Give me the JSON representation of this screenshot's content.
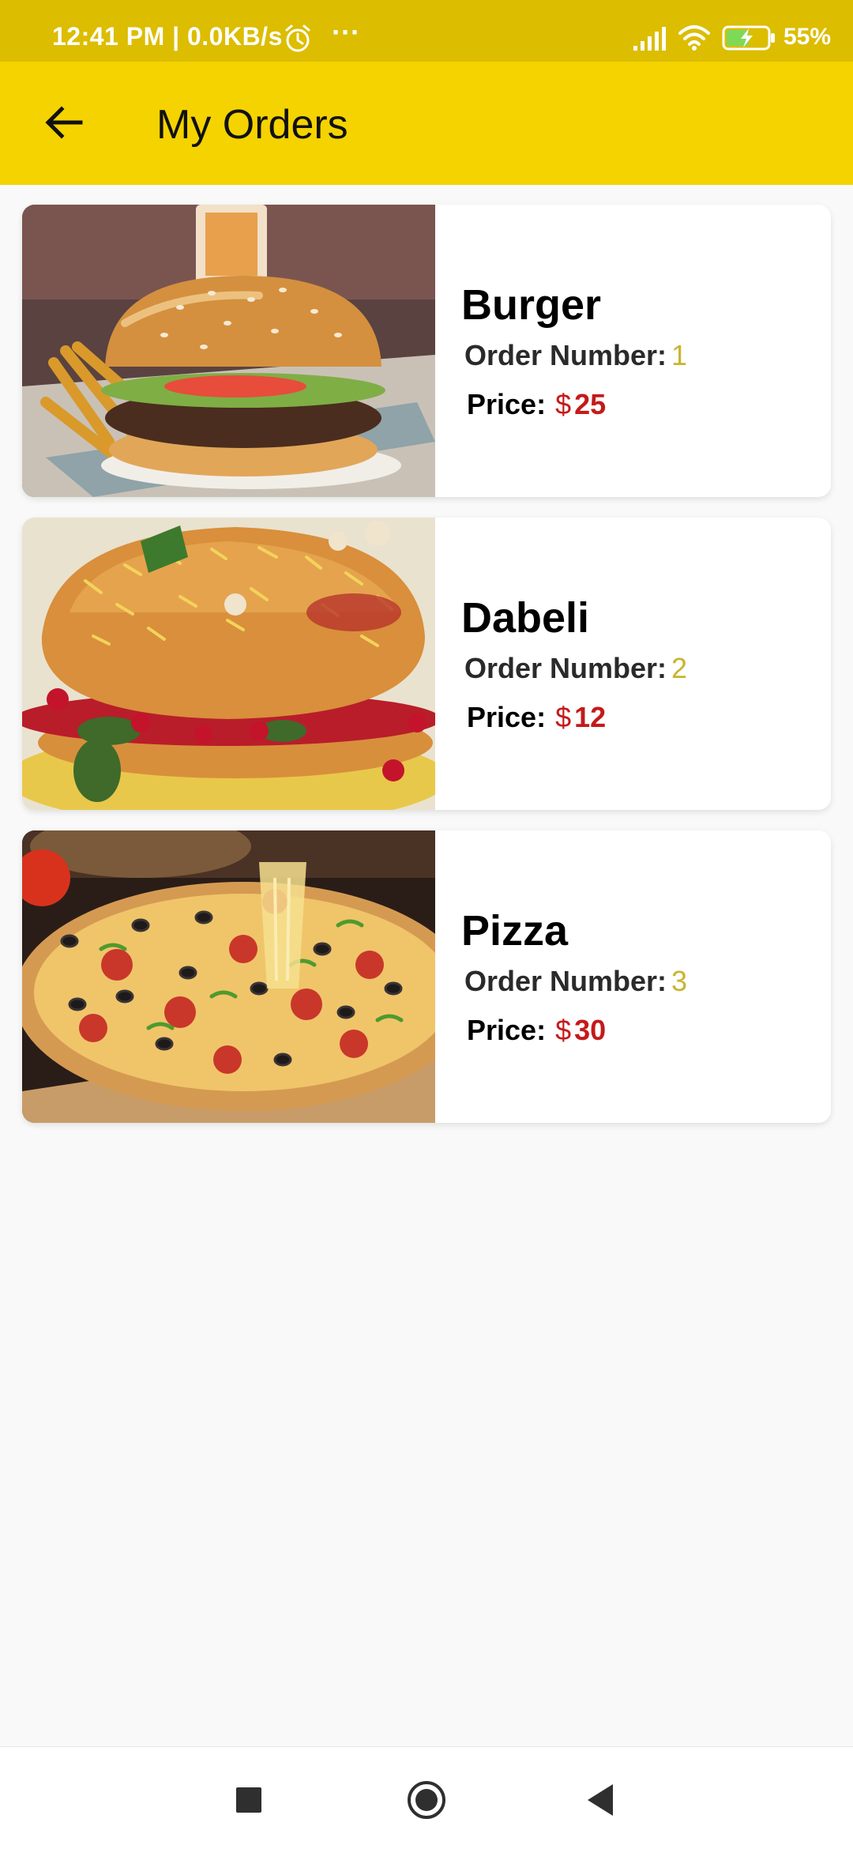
{
  "status_bar": {
    "time": "12:41 PM | 0.0KB/s",
    "more_icon": "···",
    "battery": "55%",
    "icons": [
      "alarm-icon",
      "signal-icon",
      "wifi-icon",
      "battery-charging-icon"
    ]
  },
  "app_bar": {
    "title": "My Orders",
    "back_icon": "arrow-left-icon",
    "background": "#f5d300"
  },
  "orders": [
    {
      "name": "Burger",
      "order_number_label": "Order Number:",
      "order_number": "1",
      "price_label": "Price:",
      "currency": "$",
      "price": "25"
    },
    {
      "name": "Dabeli",
      "order_number_label": "Order Number:",
      "order_number": "2",
      "price_label": "Price:",
      "currency": "$",
      "price": "12"
    },
    {
      "name": "Pizza",
      "order_number_label": "Order Number:",
      "order_number": "3",
      "price_label": "Price:",
      "currency": "$",
      "price": "30"
    }
  ],
  "nav_bar": {
    "icons": [
      "recents-square-icon",
      "home-circle-icon",
      "back-triangle-icon"
    ]
  },
  "colors": {
    "status_bar": "#dcbd00",
    "accent": "#f5d300",
    "order_number": "#c9b42e",
    "price": "#c41a1a"
  }
}
